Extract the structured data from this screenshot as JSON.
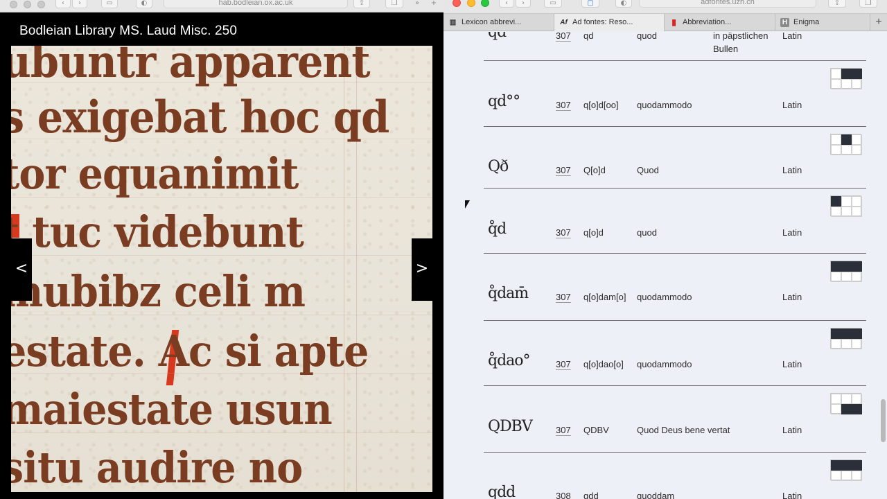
{
  "left_window": {
    "url": "hab.bodleian.ox.ac.uk",
    "viewer_title": "Bodleian Library MS. Laud Misc. 250",
    "prev_label": "<",
    "next_label": ">",
    "manuscript_lines": [
      "ubuntr apparent",
      "s exigebat hoc qd",
      "tor equanimit",
      "t tuc videbunt",
      "mubibz celi m",
      "estate. Ac si apte",
      "maiestate usun",
      "situ audire no"
    ]
  },
  "right_window": {
    "url": "adfontes.uzh.ch",
    "tabs": [
      {
        "label": "Lexicon abbrevi...",
        "icon": "library-icon",
        "active": false
      },
      {
        "label": "Ad fontes: Reso...",
        "icon": "Af",
        "active": true
      },
      {
        "label": "Abbreviation...",
        "icon": "pdf-icon",
        "active": false
      },
      {
        "label": "Enigma",
        "icon": "H",
        "active": false
      }
    ],
    "rows": [
      {
        "glyph": "qd",
        "num": "307",
        "abbr": "qd",
        "word": "quod",
        "context": "in päpstlichen Bullen",
        "lang": "Latin",
        "grid": null
      },
      {
        "glyph": "qd°°",
        "num": "307",
        "abbr": "q[o]d[oo]",
        "word": "quodammodo",
        "context": "",
        "lang": "Latin",
        "grid": [
          0,
          1,
          1,
          0,
          0,
          0
        ]
      },
      {
        "glyph": "Qð",
        "num": "307",
        "abbr": "Q[o]d",
        "word": "Quod",
        "context": "",
        "lang": "Latin",
        "grid": [
          0,
          1,
          0,
          0,
          0,
          0
        ]
      },
      {
        "glyph": "q̊d",
        "num": "307",
        "abbr": "q[o]d",
        "word": "quod",
        "context": "",
        "lang": "Latin",
        "grid": [
          1,
          0,
          0,
          0,
          0,
          0
        ]
      },
      {
        "glyph": "q̊dam̄",
        "num": "307",
        "abbr": "q[o]dam[o]",
        "word": "quodammodo",
        "context": "",
        "lang": "Latin",
        "grid": [
          1,
          1,
          1,
          0,
          0,
          0
        ]
      },
      {
        "glyph": "q̊dao°",
        "num": "307",
        "abbr": "q[o]dao[o]",
        "word": "quodammodo",
        "context": "",
        "lang": "Latin",
        "grid": [
          1,
          1,
          1,
          0,
          0,
          0
        ]
      },
      {
        "glyph": "QDBV",
        "num": "307",
        "abbr": "QDBV",
        "word": "Quod Deus bene vertat",
        "context": "",
        "lang": "Latin",
        "grid": [
          0,
          0,
          0,
          0,
          1,
          1
        ]
      },
      {
        "glyph": "qdd",
        "num": "308",
        "abbr": "qdd",
        "word": "quoddam",
        "context": "",
        "lang": "Latin",
        "grid": [
          1,
          1,
          1,
          0,
          0,
          0
        ]
      }
    ]
  }
}
